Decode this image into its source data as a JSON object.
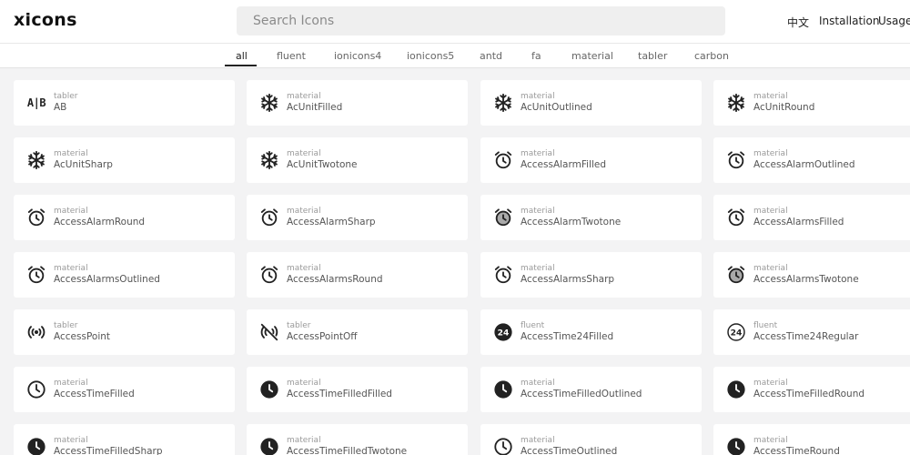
{
  "app": {
    "logo": "xicons"
  },
  "search": {
    "placeholder": "Search Icons"
  },
  "nav": {
    "lang": "中文",
    "installation": "Installation",
    "usage": "Usage"
  },
  "tabs": [
    "all",
    "fluent",
    "ionicons4",
    "ionicons5",
    "antd",
    "fa",
    "material",
    "tabler",
    "carbon"
  ],
  "active_tab": "all",
  "icons": [
    {
      "lib": "tabler",
      "name": "AB",
      "icon": "ab-icon"
    },
    {
      "lib": "material",
      "name": "AcUnitFilled",
      "icon": "snowflake-icon"
    },
    {
      "lib": "material",
      "name": "AcUnitOutlined",
      "icon": "snowflake-icon"
    },
    {
      "lib": "material",
      "name": "AcUnitRound",
      "icon": "snowflake-icon"
    },
    {
      "lib": "material",
      "name": "AcUnitSharp",
      "icon": "snowflake-icon"
    },
    {
      "lib": "material",
      "name": "AcUnitTwotone",
      "icon": "snowflake-icon"
    },
    {
      "lib": "material",
      "name": "AccessAlarmFilled",
      "icon": "alarm-clock-icon"
    },
    {
      "lib": "material",
      "name": "AccessAlarmOutlined",
      "icon": "alarm-clock-icon"
    },
    {
      "lib": "material",
      "name": "AccessAlarmRound",
      "icon": "alarm-clock-icon"
    },
    {
      "lib": "material",
      "name": "AccessAlarmSharp",
      "icon": "alarm-clock-icon"
    },
    {
      "lib": "material",
      "name": "AccessAlarmTwotone",
      "icon": "alarm-clock-twotone-icon"
    },
    {
      "lib": "material",
      "name": "AccessAlarmsFilled",
      "icon": "alarm-clock-icon"
    },
    {
      "lib": "material",
      "name": "AccessAlarmsOutlined",
      "icon": "alarm-clock-icon"
    },
    {
      "lib": "material",
      "name": "AccessAlarmsRound",
      "icon": "alarm-clock-icon"
    },
    {
      "lib": "material",
      "name": "AccessAlarmsSharp",
      "icon": "alarm-clock-icon"
    },
    {
      "lib": "material",
      "name": "AccessAlarmsTwotone",
      "icon": "alarm-clock-twotone-icon"
    },
    {
      "lib": "tabler",
      "name": "AccessPoint",
      "icon": "access-point-icon"
    },
    {
      "lib": "tabler",
      "name": "AccessPointOff",
      "icon": "access-point-off-icon"
    },
    {
      "lib": "fluent",
      "name": "AccessTime24Filled",
      "icon": "clock-24-filled-icon"
    },
    {
      "lib": "fluent",
      "name": "AccessTime24Regular",
      "icon": "clock-24-regular-icon"
    },
    {
      "lib": "material",
      "name": "AccessTimeFilled",
      "icon": "clock-outline-icon"
    },
    {
      "lib": "material",
      "name": "AccessTimeFilledFilled",
      "icon": "clock-filled-icon"
    },
    {
      "lib": "material",
      "name": "AccessTimeFilledOutlined",
      "icon": "clock-filled-icon"
    },
    {
      "lib": "material",
      "name": "AccessTimeFilledRound",
      "icon": "clock-filled-icon"
    },
    {
      "lib": "material",
      "name": "AccessTimeFilledSharp",
      "icon": "clock-filled-icon"
    },
    {
      "lib": "material",
      "name": "AccessTimeFilledTwotone",
      "icon": "clock-filled-icon"
    },
    {
      "lib": "material",
      "name": "AccessTimeOutlined",
      "icon": "clock-outline-icon"
    },
    {
      "lib": "material",
      "name": "AccessTimeRound",
      "icon": "clock-filled-icon"
    }
  ]
}
